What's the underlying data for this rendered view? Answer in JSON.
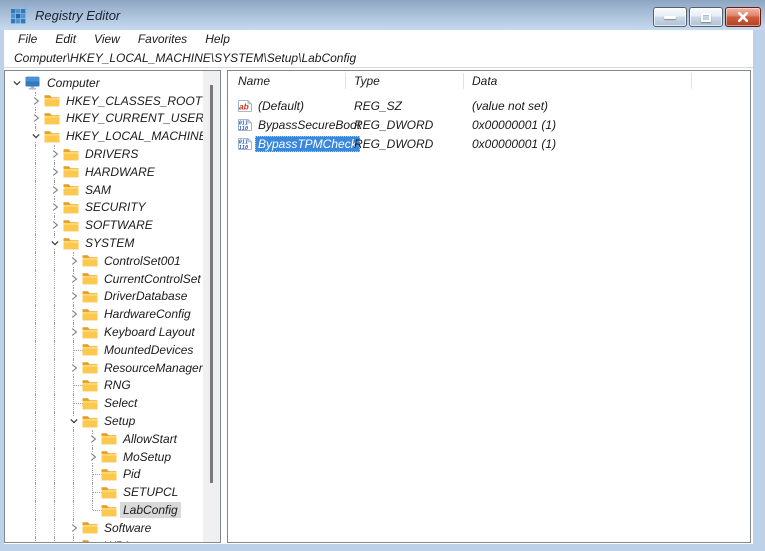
{
  "window": {
    "title": "Registry Editor",
    "controls": [
      {
        "name": "minimize-button",
        "icon": "minimize-icon"
      },
      {
        "name": "maximize-button",
        "icon": "maximize-icon"
      },
      {
        "name": "close-button",
        "icon": "close-icon"
      }
    ]
  },
  "menu": {
    "items": [
      "File",
      "Edit",
      "View",
      "Favorites",
      "Help"
    ]
  },
  "address": {
    "path": "Computer\\HKEY_LOCAL_MACHINE\\SYSTEM\\Setup\\LabConfig"
  },
  "tree": {
    "rows": [
      {
        "label": "Computer",
        "level": 0,
        "expander": "expanded",
        "icon": "computer-icon",
        "guides": []
      },
      {
        "label": "HKEY_CLASSES_ROOT",
        "level": 1,
        "expander": "collapsed",
        "icon": "folder-icon",
        "guides": [
          1
        ]
      },
      {
        "label": "HKEY_CURRENT_USER",
        "level": 1,
        "expander": "collapsed",
        "icon": "folder-icon",
        "guides": [
          1
        ]
      },
      {
        "label": "HKEY_LOCAL_MACHINE",
        "level": 1,
        "expander": "expanded",
        "icon": "folder-icon",
        "guides": [
          1
        ]
      },
      {
        "label": "DRIVERS",
        "level": 2,
        "expander": "collapsed",
        "icon": "folder-icon",
        "guides": [
          1,
          2
        ]
      },
      {
        "label": "HARDWARE",
        "level": 2,
        "expander": "collapsed",
        "icon": "folder-icon",
        "guides": [
          1,
          2
        ]
      },
      {
        "label": "SAM",
        "level": 2,
        "expander": "collapsed",
        "icon": "folder-icon",
        "guides": [
          1,
          2
        ]
      },
      {
        "label": "SECURITY",
        "level": 2,
        "expander": "collapsed",
        "icon": "folder-icon",
        "guides": [
          1,
          2
        ]
      },
      {
        "label": "SOFTWARE",
        "level": 2,
        "expander": "collapsed",
        "icon": "folder-icon",
        "guides": [
          1,
          2
        ]
      },
      {
        "label": "SYSTEM",
        "level": 2,
        "expander": "expanded",
        "icon": "folder-icon",
        "guides": [
          1,
          2
        ]
      },
      {
        "label": "ControlSet001",
        "level": 3,
        "expander": "collapsed",
        "icon": "folder-icon",
        "guides": [
          1,
          2,
          3
        ]
      },
      {
        "label": "CurrentControlSet",
        "level": 3,
        "expander": "collapsed",
        "icon": "folder-icon",
        "guides": [
          1,
          2,
          3
        ]
      },
      {
        "label": "DriverDatabase",
        "level": 3,
        "expander": "collapsed",
        "icon": "folder-icon",
        "guides": [
          1,
          2,
          3
        ]
      },
      {
        "label": "HardwareConfig",
        "level": 3,
        "expander": "collapsed",
        "icon": "folder-icon",
        "guides": [
          1,
          2,
          3
        ]
      },
      {
        "label": "Keyboard Layout",
        "level": 3,
        "expander": "collapsed",
        "icon": "folder-icon",
        "guides": [
          1,
          2,
          3
        ]
      },
      {
        "label": "MountedDevices",
        "level": 3,
        "expander": "none",
        "icon": "folder-icon",
        "guides": [
          1,
          2,
          3
        ],
        "stub": true
      },
      {
        "label": "ResourceManager",
        "level": 3,
        "expander": "collapsed",
        "icon": "folder-icon",
        "guides": [
          1,
          2,
          3
        ]
      },
      {
        "label": "RNG",
        "level": 3,
        "expander": "none",
        "icon": "folder-icon",
        "guides": [
          1,
          2,
          3
        ],
        "stub": true
      },
      {
        "label": "Select",
        "level": 3,
        "expander": "none",
        "icon": "folder-icon",
        "guides": [
          1,
          2,
          3
        ],
        "stub": true
      },
      {
        "label": "Setup",
        "level": 3,
        "expander": "expanded",
        "icon": "folder-icon",
        "guides": [
          1,
          2,
          3
        ]
      },
      {
        "label": "AllowStart",
        "level": 4,
        "expander": "collapsed",
        "icon": "folder-icon",
        "guides": [
          1,
          2,
          3,
          4
        ]
      },
      {
        "label": "MoSetup",
        "level": 4,
        "expander": "collapsed",
        "icon": "folder-icon",
        "guides": [
          1,
          2,
          3,
          4
        ]
      },
      {
        "label": "Pid",
        "level": 4,
        "expander": "none",
        "icon": "folder-icon",
        "guides": [
          1,
          2,
          3,
          4
        ],
        "stub": true
      },
      {
        "label": "SETUPCL",
        "level": 4,
        "expander": "none",
        "icon": "folder-icon",
        "guides": [
          1,
          2,
          3,
          4
        ],
        "stub": true
      },
      {
        "label": "LabConfig",
        "level": 4,
        "expander": "none",
        "icon": "folder-icon",
        "guides": [
          1,
          2,
          3
        ],
        "guides_half": [
          4
        ],
        "stub": true,
        "selected": true
      },
      {
        "label": "Software",
        "level": 3,
        "expander": "collapsed",
        "icon": "folder-icon",
        "guides": [
          1,
          2,
          3
        ]
      },
      {
        "label": "WPA",
        "level": 3,
        "expander": "none",
        "icon": "folder-icon",
        "guides": [
          1,
          2,
          3
        ],
        "stub": true
      }
    ]
  },
  "list": {
    "columns": [
      "Name",
      "Type",
      "Data"
    ],
    "rows": [
      {
        "icon": "string-icon",
        "name": "(Default)",
        "type": "REG_SZ",
        "data": "(value not set)"
      },
      {
        "icon": "dword-icon",
        "name": "BypassSecureBoot",
        "type": "REG_DWORD",
        "data": "0x00000001 (1)"
      },
      {
        "icon": "dword-icon",
        "name": "BypassTPMCheck",
        "type": "REG_DWORD",
        "data": "0x00000001 (1)",
        "selected": true
      }
    ]
  },
  "colors": {
    "titlebar_top": "#8ca6c2",
    "titlebar_bottom": "#c6daf0",
    "window_border": "#bdd2e9",
    "panel_border": "#83878f",
    "selection_active": "#3a87de",
    "selection_inactive": "#d9d9d9",
    "folder_front": "#fdc84e",
    "folder_back": "#e79b27",
    "close_button_red": "#d05a38",
    "scrollbar_thumb": "#7a7a7a",
    "tree_guide": "#9e9e9e"
  }
}
